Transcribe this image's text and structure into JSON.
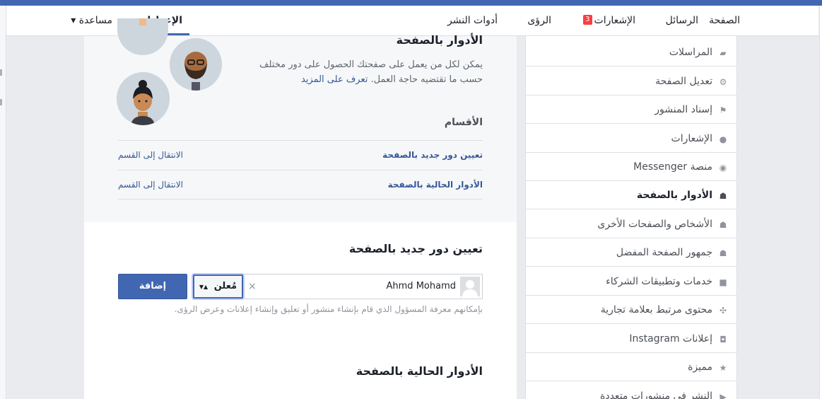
{
  "nav": {
    "page": "الصفحة",
    "messages": "الرسائل",
    "notifications": "الإشعارات",
    "notifications_count": "3",
    "insights": "الرؤى",
    "publishing_tools": "أدوات النشر",
    "settings": "الإعدادات",
    "help": "مساعدة ▾"
  },
  "roles_intro": {
    "title": "الأدوار بالصفحة",
    "description": "يمكن لكل من يعمل على صفحتك الحصول على دور مختلف حسب ما تقتضيه حاجة العمل.",
    "learn_more": "تعرف على المزيد"
  },
  "sections": {
    "heading": "الأقسام",
    "rows": [
      {
        "label": "تعيين دور جديد بالصفحة",
        "action": "الانتقال إلى القسم"
      },
      {
        "label": "الأدوار الحالية بالصفحة",
        "action": "الانتقال إلى القسم"
      }
    ]
  },
  "assign": {
    "title": "تعيين دور جديد بالصفحة",
    "user_value": "Ahmd Mohamd",
    "clear_glyph": "×",
    "role_selected": "مُعلن",
    "add_button": "إضافة",
    "help_text": "بإمكانهم معرفة المسؤول الذي قام بإنشاء منشور أو تعليق وإنشاء إعلانات وعرض الرؤى."
  },
  "current_roles": {
    "title": "الأدوار الحالية بالصفحة"
  },
  "sidebar": {
    "items": [
      {
        "label": "المراسلات",
        "icon": "chat-icon"
      },
      {
        "label": "تعديل الصفحة",
        "icon": "gear-icon"
      },
      {
        "label": "إسناد المنشور",
        "icon": "flag-icon"
      },
      {
        "label": "الإشعارات",
        "icon": "globe-icon"
      },
      {
        "label": "منصة Messenger",
        "icon": "messenger-icon"
      },
      {
        "label": "الأدوار بالصفحة",
        "icon": "person-icon",
        "active": true
      },
      {
        "label": "الأشخاص والصفحات الأخرى",
        "icon": "add-person-icon"
      },
      {
        "label": "جمهور الصفحة المفضل",
        "icon": "audience-icon"
      },
      {
        "label": "خدمات وتطبيقات الشركاء",
        "icon": "box-icon"
      },
      {
        "label": "محتوى مرتبط بعلامة تجارية",
        "icon": "handshake-icon"
      },
      {
        "label": "إعلانات Instagram",
        "icon": "instagram-icon"
      },
      {
        "label": "مميزة",
        "icon": "star-icon"
      },
      {
        "label": "النشر في منشورات متعددة",
        "icon": "video-icon"
      }
    ]
  },
  "colors": {
    "brand_blue": "#4267b2",
    "link_blue": "#365899",
    "badge_red": "#fa3e3e",
    "background": "#e9ebee"
  }
}
